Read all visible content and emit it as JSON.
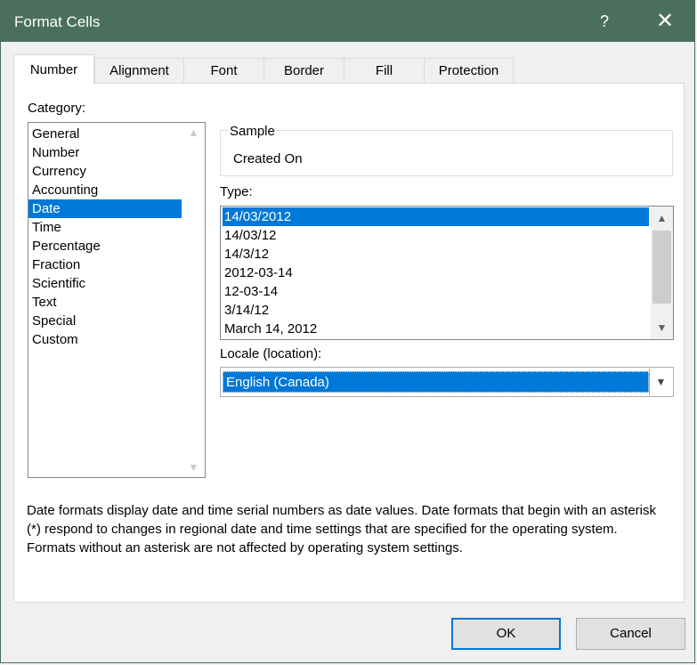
{
  "window": {
    "title": "Format Cells",
    "help": "?",
    "close": "✕"
  },
  "tabs": [
    {
      "label": "Number"
    },
    {
      "label": "Alignment"
    },
    {
      "label": "Font"
    },
    {
      "label": "Border"
    },
    {
      "label": "Fill"
    },
    {
      "label": "Protection"
    }
  ],
  "category": {
    "label": "Category:",
    "items": [
      "General",
      "Number",
      "Currency",
      "Accounting",
      "Date",
      "Time",
      "Percentage",
      "Fraction",
      "Scientific",
      "Text",
      "Special",
      "Custom"
    ],
    "selected": "Date"
  },
  "sample": {
    "label": "Sample",
    "value": "Created On"
  },
  "type": {
    "label": "Type:",
    "items": [
      "14/03/2012",
      "14/03/12",
      "14/3/12",
      "2012-03-14",
      "12-03-14",
      "3/14/12",
      "March 14, 2012"
    ],
    "selected": "14/03/2012"
  },
  "locale": {
    "label": "Locale (location):",
    "value": "English (Canada)"
  },
  "description": "Date formats display date and time serial numbers as date values.  Date formats that begin with an asterisk (*) respond to changes in regional date and time settings that are specified for the operating system. Formats without an asterisk are not affected by operating system settings.",
  "buttons": {
    "ok": "OK",
    "cancel": "Cancel"
  },
  "colors": {
    "titlebar": "#4a6f5d",
    "selection": "#0078d7"
  }
}
